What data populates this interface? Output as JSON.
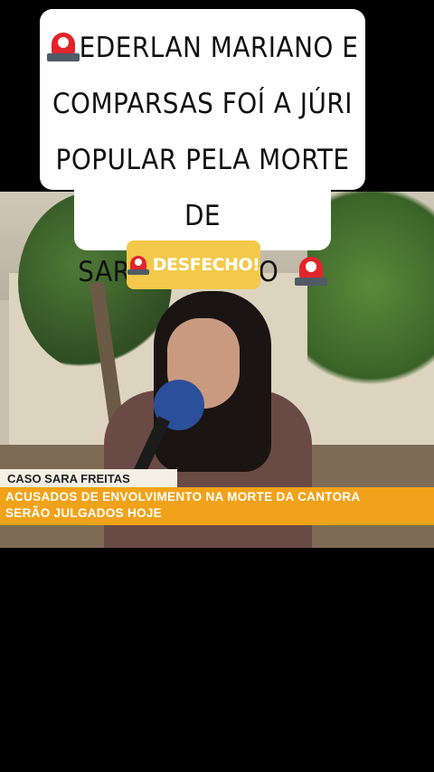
{
  "headline": {
    "line1": "EDERLAN MARIANO E",
    "line2": "COMPARSAS FOÍ A JÚRI",
    "line3": "POPULAR PELA MORTE DE",
    "line4": "SARA MARIANO"
  },
  "badge": {
    "label": "DESFECHO!"
  },
  "news_tag": {
    "label": "CASO SARA FREITAS"
  },
  "news_caption": {
    "line1": "ACUSADOS DE ENVOLVIMENTO NA MORTE DA CANTORA",
    "line2": "SERÃO JULGADOS HOJE"
  },
  "icons": [
    "siren-icon"
  ],
  "colors": {
    "badge_bg": "#f2c94a",
    "caption_bar": "#f0a21a",
    "siren_red": "#e2242b"
  }
}
